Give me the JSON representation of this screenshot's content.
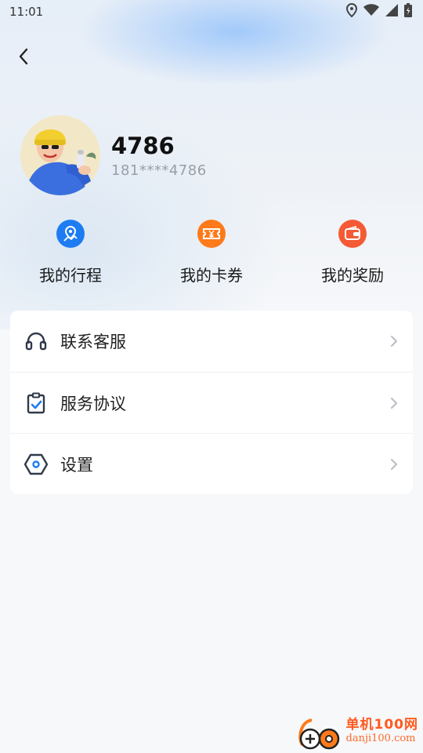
{
  "status_bar": {
    "time": "11:01"
  },
  "profile": {
    "name": "4786",
    "phone": "181****4786"
  },
  "quick_actions": [
    {
      "label": "我的行程",
      "icon": "map-location-icon",
      "color": "#1e7cf2"
    },
    {
      "label": "我的卡券",
      "icon": "ticket-yen-icon",
      "color": "#ff7a1a"
    },
    {
      "label": "我的奖励",
      "icon": "wallet-icon",
      "color": "#f55a34"
    }
  ],
  "menu": [
    {
      "label": "联系客服",
      "icon": "headset-icon"
    },
    {
      "label": "服务协议",
      "icon": "clipboard-check-icon"
    },
    {
      "label": "设置",
      "icon": "settings-hexagon-icon"
    }
  ],
  "watermark": {
    "title": "单机100网",
    "url": "danji100.com"
  },
  "colors": {
    "accent_blue": "#1e7cf2",
    "accent_orange": "#ff7a1a",
    "accent_red": "#f55a34",
    "menu_icon": "#2f3a4a"
  }
}
